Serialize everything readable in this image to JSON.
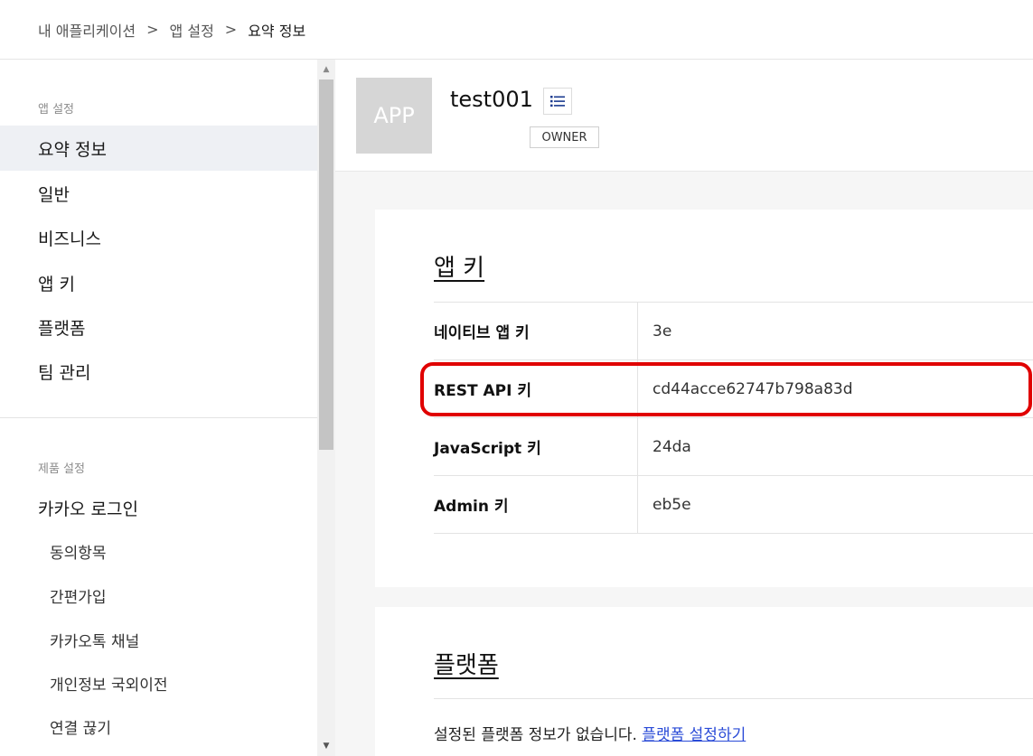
{
  "breadcrumb": {
    "items": [
      "내 애플리케이션",
      "앱 설정",
      "요약 정보"
    ],
    "separator": ">"
  },
  "sidebar": {
    "section1": "앱 설정",
    "items": [
      "요약 정보",
      "일반",
      "비즈니스",
      "앱 키",
      "플랫폼",
      "팀 관리"
    ],
    "active_index": 0,
    "section2": "제품 설정",
    "product": "카카오 로그인",
    "subitems": [
      "동의항목",
      "간편가입",
      "카카오톡 채널",
      "개인정보 국외이전",
      "연결 끊기"
    ]
  },
  "app": {
    "thumb": "APP",
    "name": "test001",
    "menu_icon": "list-icon",
    "role": "OWNER"
  },
  "app_keys": {
    "title": "앱 키",
    "rows": [
      {
        "label": "네이티브 앱 키",
        "value": "3e"
      },
      {
        "label": "REST API 키",
        "value": "cd44acce62747b798a83d"
      },
      {
        "label": "JavaScript 키",
        "value": "24da"
      },
      {
        "label": "Admin 키",
        "value": "eb5e"
      }
    ],
    "highlight_color": "#e00000"
  },
  "platform": {
    "title": "플랫폼",
    "message": "설정된 플랫폼 정보가 없습니다.",
    "link": "플랫폼 설정하기"
  }
}
